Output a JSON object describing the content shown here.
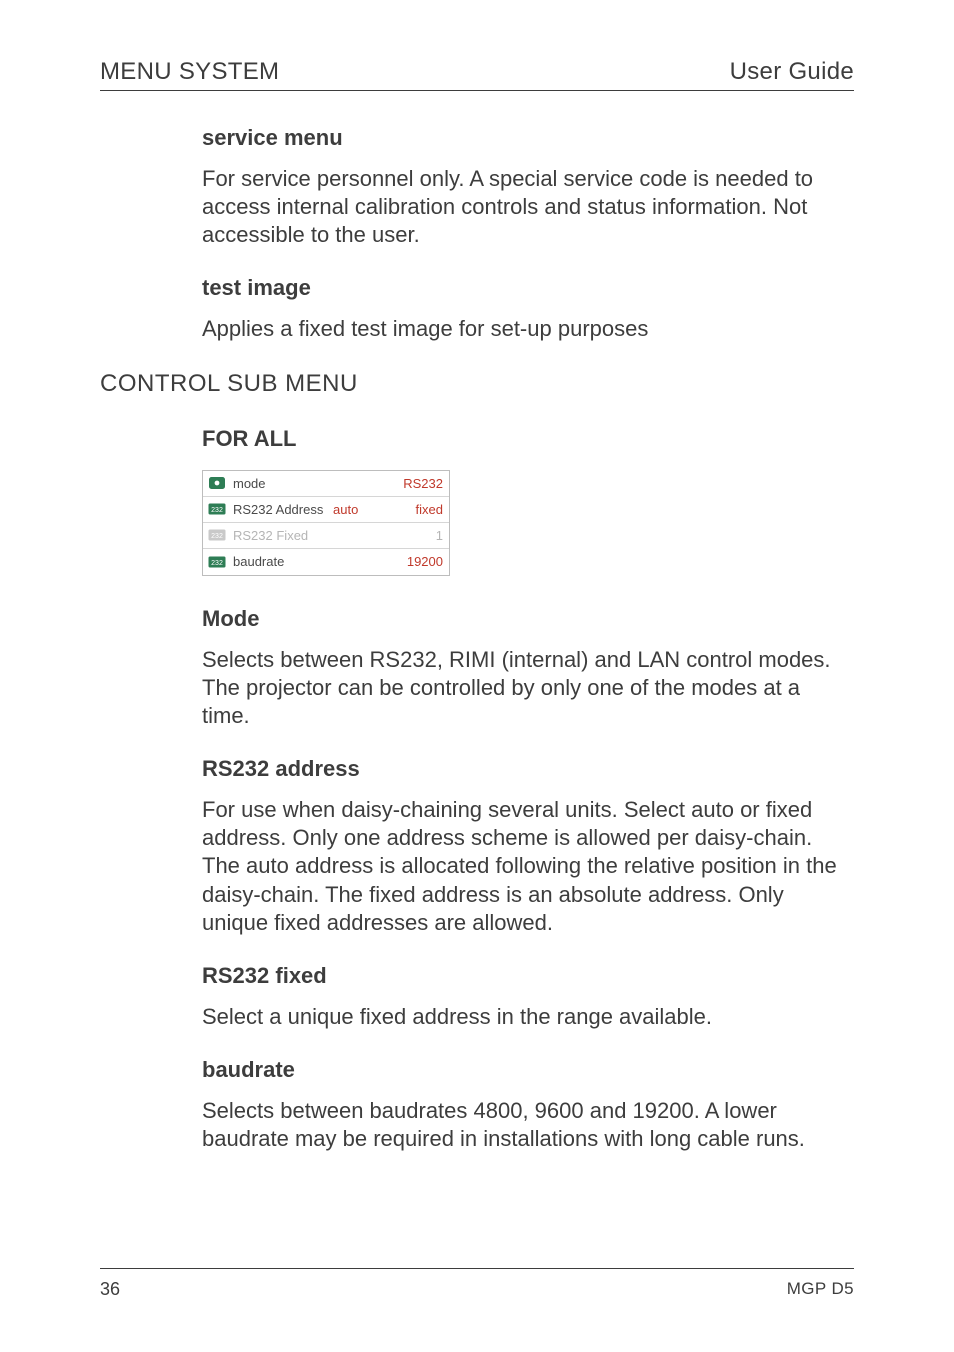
{
  "header": {
    "left": "MENU SYSTEM",
    "right": "User Guide"
  },
  "sections": {
    "service_menu": {
      "title": "service menu",
      "body": "For service personnel only. A special service code is needed to access internal calibration controls and status information. Not accessible to the user."
    },
    "test_image": {
      "title": "test image",
      "body": "Applies a fixed test image for set-up purposes"
    },
    "control_sub_menu": {
      "title": "CONTROL SUB MENU",
      "for_all": "FOR ALL"
    },
    "mode": {
      "title": "Mode",
      "body": "Selects between RS232, RIMI (internal) and LAN control modes. The projector can be controlled by only one of the modes at a time."
    },
    "rs232_address": {
      "title": "RS232 address",
      "body": "For use when daisy-chaining several units. Select auto or fixed address. Only one address scheme is allowed per daisy-chain. The auto address is allocated following the relative position in the daisy-chain. The fixed address is an absolute address. Only unique fixed addresses are allowed."
    },
    "rs232_fixed": {
      "title": "RS232 fixed",
      "body": "Select a unique fixed address in the range available."
    },
    "baudrate": {
      "title": "baudrate",
      "body": "Selects between baudrates 4800, 9600 and 19200. A lower baudrate may be required in installations with long cable runs."
    }
  },
  "menu_table": {
    "rows": [
      {
        "icon": "eye-icon",
        "label": "mode",
        "mid": "",
        "value": "RS232",
        "value_style": "red",
        "disabled": false,
        "active": true
      },
      {
        "icon": "rs232-icon",
        "label": "RS232 Address",
        "mid": "auto",
        "value": "fixed",
        "value_style": "black",
        "disabled": false,
        "active": true
      },
      {
        "icon": "rs232-icon",
        "label": "RS232 Fixed",
        "mid": "",
        "value": "1",
        "value_style": "red",
        "disabled": true,
        "active": false
      },
      {
        "icon": "rs232-icon",
        "label": "baudrate",
        "mid": "",
        "value": "19200",
        "value_style": "red",
        "disabled": false,
        "active": false
      }
    ]
  },
  "footer": {
    "page": "36",
    "doc": "MGP D5"
  }
}
